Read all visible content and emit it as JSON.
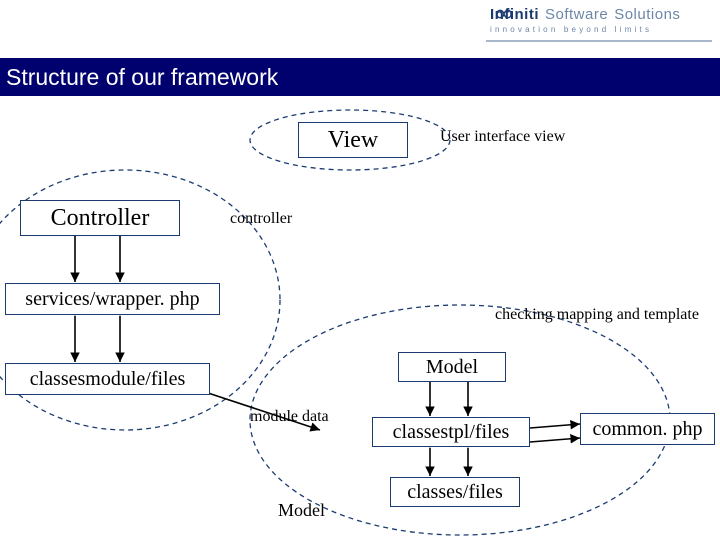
{
  "logo": {
    "brand_a": "Infiniti",
    "brand_b": "Software",
    "brand_c": "Solutions",
    "tagline": "innovation beyond limits"
  },
  "title": "Structure of our framework",
  "nodes": {
    "view": "View",
    "controller": "Controller",
    "services": "services/wrapper. php",
    "classesmodule": "classesmodule/files",
    "model_top": "Model",
    "classestpl": "classestpl/files",
    "classes": "classes/files",
    "common": "common. php",
    "model_bottom": "Model"
  },
  "annotations": {
    "view": "User interface view",
    "controller": "controller",
    "services": "checking mapping and template",
    "moduledata": "module data"
  }
}
